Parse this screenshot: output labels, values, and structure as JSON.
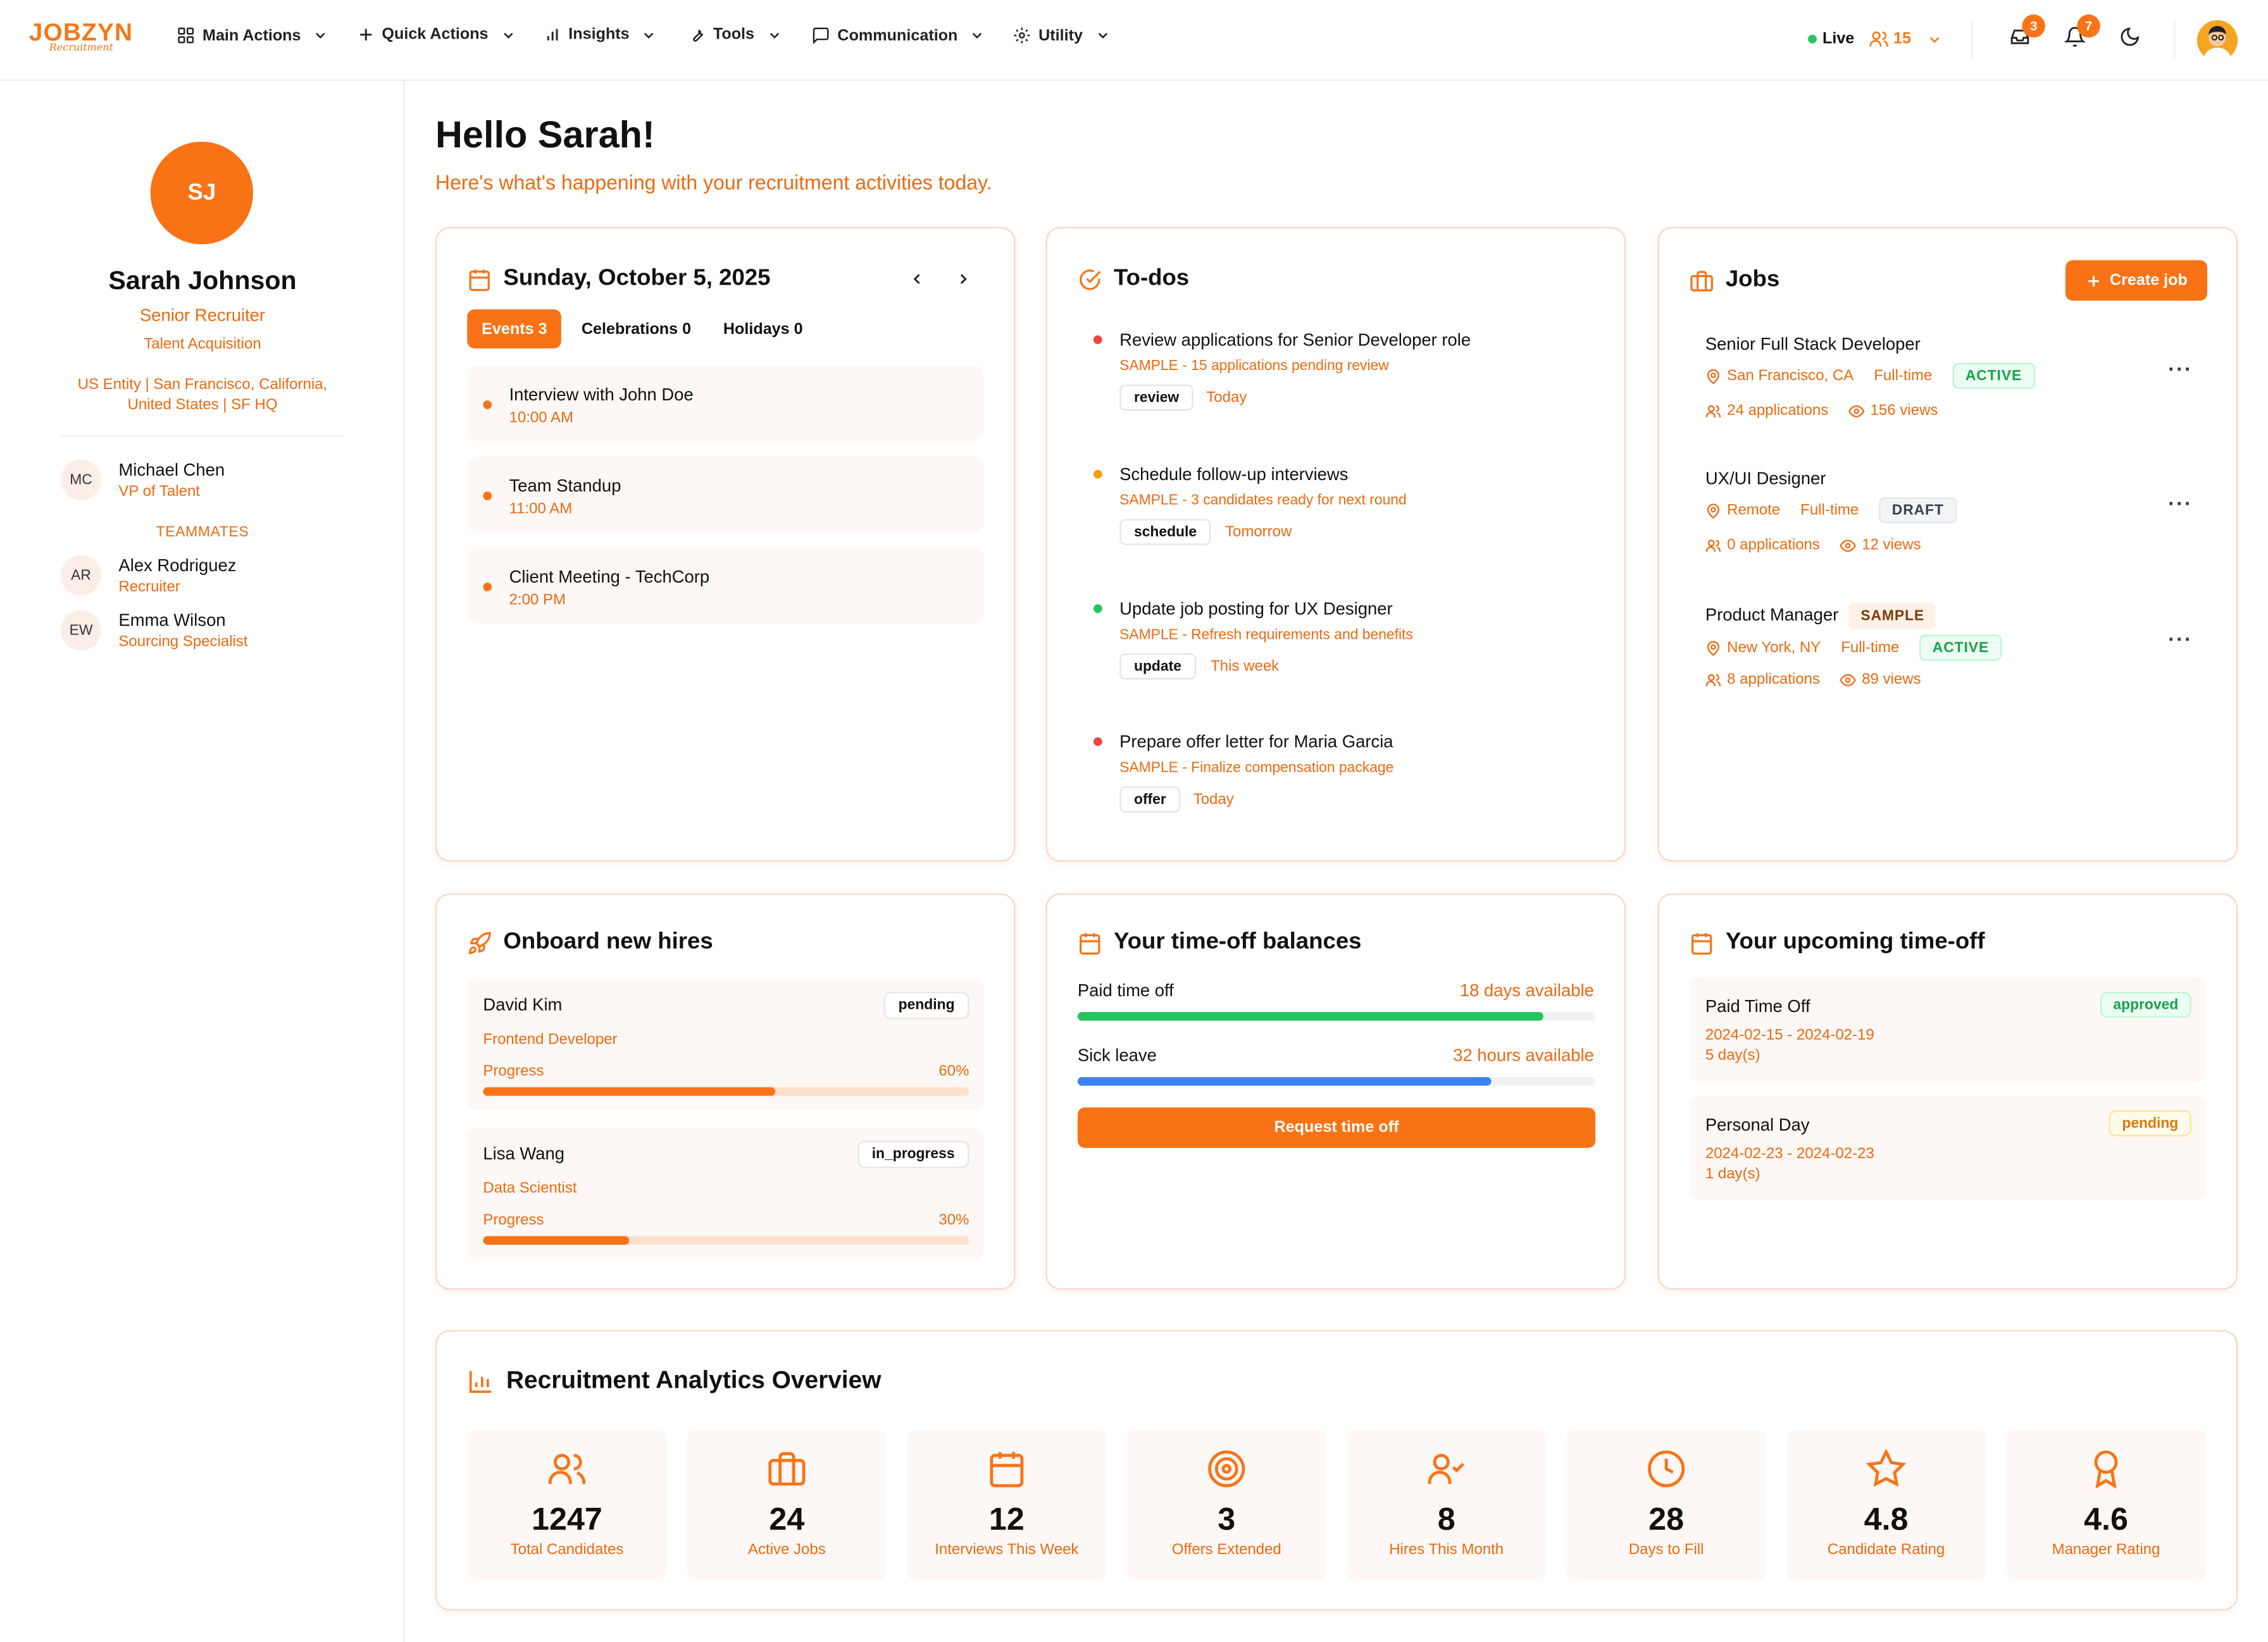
{
  "brand": {
    "name": "JOBZYN",
    "tagline": "Recruitment"
  },
  "nav": {
    "items": [
      "Main Actions",
      "Quick Actions",
      "Insights",
      "Tools",
      "Communication",
      "Utility"
    ],
    "live_label": "Live",
    "live_count": "15",
    "inbox_badge": "3",
    "notif_badge": "7"
  },
  "user": {
    "initials": "SJ",
    "name": "Sarah Johnson",
    "title": "Senior Recruiter",
    "department": "Talent Acquisition",
    "location": "US Entity | San Francisco, California, United States | SF HQ"
  },
  "manager": {
    "initials": "MC",
    "name": "Michael Chen",
    "role": "VP of Talent"
  },
  "teammates_label": "TEAMMATES",
  "teammates": [
    {
      "initials": "AR",
      "name": "Alex Rodriguez",
      "role": "Recruiter"
    },
    {
      "initials": "EW",
      "name": "Emma Wilson",
      "role": "Sourcing Specialist"
    }
  ],
  "greeting": {
    "title": "Hello Sarah!",
    "subtitle": "Here's what's happening with your recruitment activities today."
  },
  "calendar": {
    "date": "Sunday, October 5, 2025",
    "tabs": [
      "Events 3",
      "Celebrations 0",
      "Holidays 0"
    ],
    "events": [
      {
        "title": "Interview with John Doe",
        "time": "10:00 AM"
      },
      {
        "title": "Team Standup",
        "time": "11:00 AM"
      },
      {
        "title": "Client Meeting - TechCorp",
        "time": "2:00 PM"
      }
    ]
  },
  "todos": {
    "title": "To-dos",
    "items": [
      {
        "title": "Review applications for Senior Developer role",
        "sub": "SAMPLE - 15 applications pending review",
        "tag": "review",
        "when": "Today",
        "color": "#ef4444"
      },
      {
        "title": "Schedule follow-up interviews",
        "sub": "SAMPLE - 3 candidates ready for next round",
        "tag": "schedule",
        "when": "Tomorrow",
        "color": "#f59e0b"
      },
      {
        "title": "Update job posting for UX Designer",
        "sub": "SAMPLE - Refresh requirements and benefits",
        "tag": "update",
        "when": "This week",
        "color": "#22c55e"
      },
      {
        "title": "Prepare offer letter for Maria Garcia",
        "sub": "SAMPLE - Finalize compensation package",
        "tag": "offer",
        "when": "Today",
        "color": "#ef4444"
      }
    ]
  },
  "jobs": {
    "title": "Jobs",
    "create_label": "Create job",
    "items": [
      {
        "title": "Senior Full Stack Developer",
        "location": "San Francisco, CA",
        "type": "Full-time",
        "status": "ACTIVE",
        "applications": "24 applications",
        "views": "156 views",
        "sample": ""
      },
      {
        "title": "UX/UI Designer",
        "location": "Remote",
        "type": "Full-time",
        "status": "DRAFT",
        "applications": "0 applications",
        "views": "12 views",
        "sample": ""
      },
      {
        "title": "Product Manager",
        "location": "New York, NY",
        "type": "Full-time",
        "status": "ACTIVE",
        "applications": "8 applications",
        "views": "89 views",
        "sample": "SAMPLE"
      }
    ]
  },
  "onboard": {
    "title": "Onboard new hires",
    "progress_label": "Progress",
    "items": [
      {
        "name": "David Kim",
        "status": "pending",
        "role": "Frontend Developer",
        "progress_text": "60%",
        "progress": 0.6
      },
      {
        "name": "Lisa Wang",
        "status": "in_progress",
        "role": "Data Scientist",
        "progress_text": "30%",
        "progress": 0.3
      }
    ]
  },
  "balances": {
    "title": "Your time-off balances",
    "items": [
      {
        "label": "Paid time off",
        "value": "18 days available",
        "fill": 0.9,
        "color": "#22c55e"
      },
      {
        "label": "Sick leave",
        "value": "32 hours available",
        "fill": 0.8,
        "color": "#3b82f6"
      }
    ],
    "button": "Request time off"
  },
  "upcoming": {
    "title": "Your upcoming time-off",
    "items": [
      {
        "name": "Paid Time Off",
        "dates": "2024-02-15 - 2024-02-19",
        "days": "5 day(s)",
        "status": "approved"
      },
      {
        "name": "Personal Day",
        "dates": "2024-02-23 - 2024-02-23",
        "days": "1 day(s)",
        "status": "pending"
      }
    ]
  },
  "analytics": {
    "title": "Recruitment Analytics Overview",
    "stats": [
      {
        "value": "1247",
        "label": "Total Candidates",
        "icon": "users-icon"
      },
      {
        "value": "24",
        "label": "Active Jobs",
        "icon": "briefcase-icon"
      },
      {
        "value": "12",
        "label": "Interviews This Week",
        "icon": "calendar-icon"
      },
      {
        "value": "3",
        "label": "Offers Extended",
        "icon": "target-icon"
      },
      {
        "value": "8",
        "label": "Hires This Month",
        "icon": "user-check-icon"
      },
      {
        "value": "28",
        "label": "Days to Fill",
        "icon": "clock-icon"
      },
      {
        "value": "4.8",
        "label": "Candidate Rating",
        "icon": "star-icon"
      },
      {
        "value": "4.6",
        "label": "Manager Rating",
        "icon": "award-icon"
      }
    ]
  },
  "colors": {
    "accent": "#f97316",
    "accent_text": "#ea6a12"
  }
}
